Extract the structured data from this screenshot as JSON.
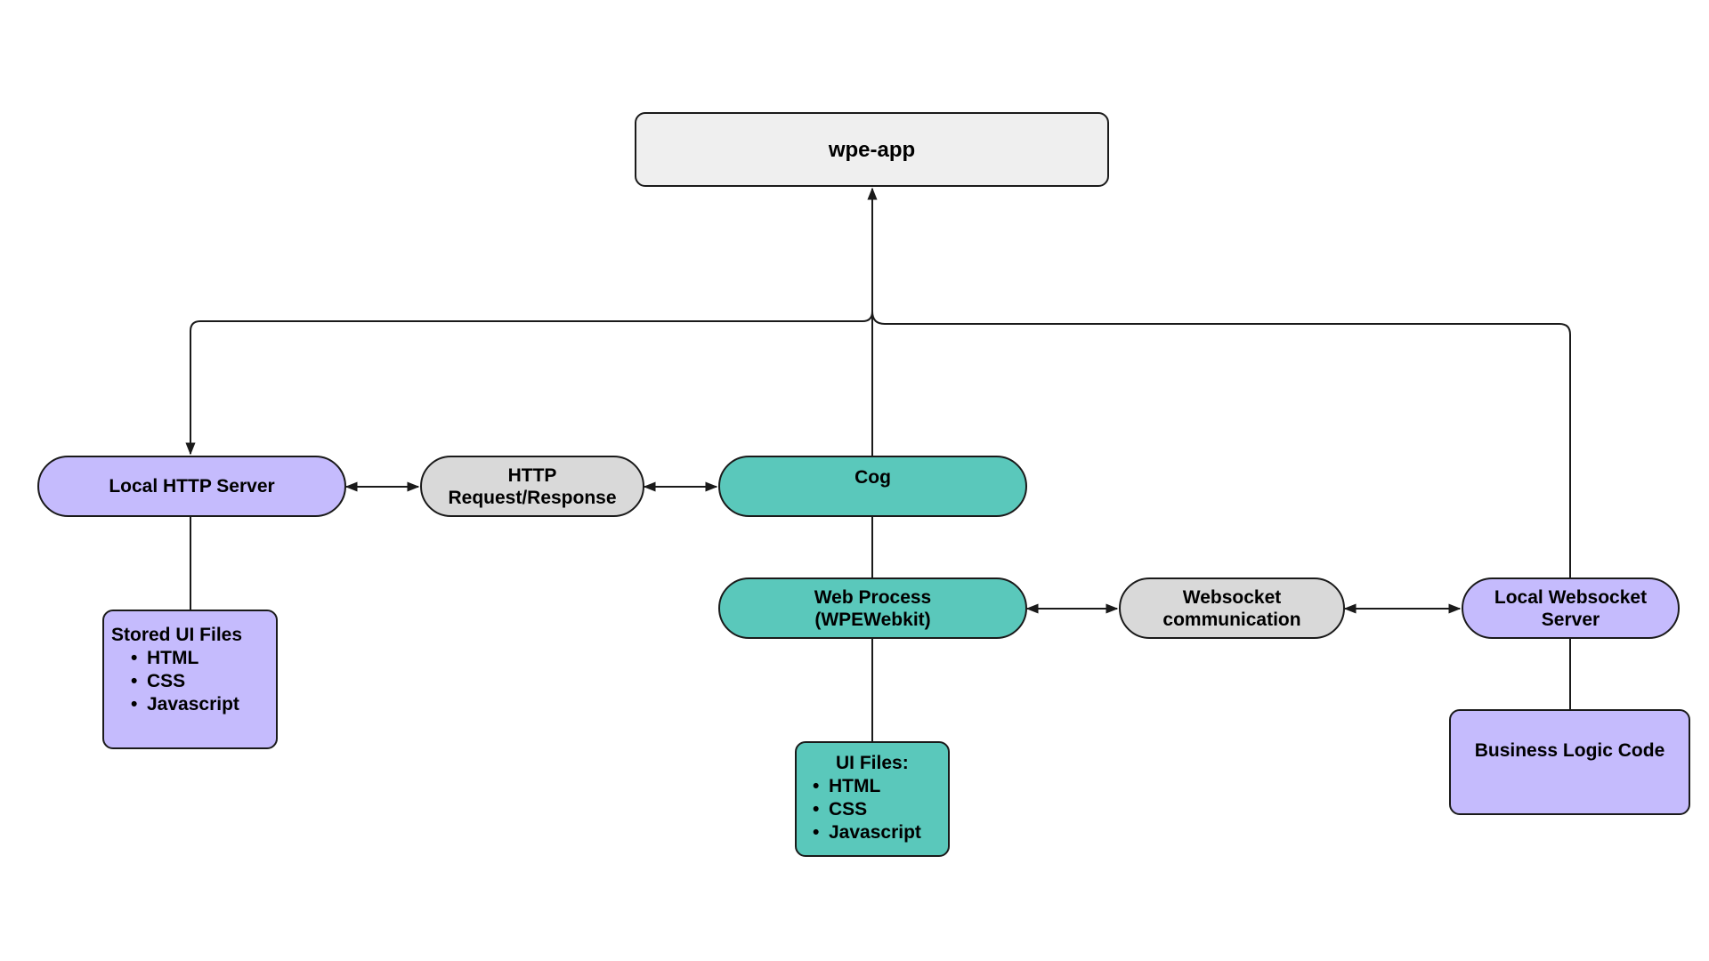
{
  "diagram": {
    "nodes": {
      "wpe_app": {
        "label": "wpe-app"
      },
      "local_http_server": {
        "label": "Local HTTP Server"
      },
      "http_request_response": {
        "line1": "HTTP",
        "line2": "Request/Response"
      },
      "cog": {
        "label": "Cog"
      },
      "web_process": {
        "line1": "Web Process",
        "line2": "(WPEWebkit)"
      },
      "websocket_communication": {
        "line1": "Websocket",
        "line2": "communication"
      },
      "local_websocket_server": {
        "line1": "Local Websocket",
        "line2": "Server"
      },
      "stored_ui_files": {
        "title": "Stored UI Files",
        "items": [
          "HTML",
          "CSS",
          "Javascript"
        ]
      },
      "ui_files": {
        "title": "UI Files:",
        "items": [
          "HTML",
          "CSS",
          "Javascript"
        ]
      },
      "business_logic_code": {
        "label": "Business Logic Code"
      }
    },
    "edges": [
      {
        "from": "cog",
        "to": "wpe_app",
        "arrow": "end"
      },
      {
        "from": "wpe_app",
        "to": "local_http_server",
        "arrow": "end"
      },
      {
        "from": "local_websocket_server",
        "to": "wpe_app",
        "arrow": "none"
      },
      {
        "from": "local_http_server",
        "to": "http_request_response",
        "arrow": "both"
      },
      {
        "from": "http_request_response",
        "to": "cog",
        "arrow": "both"
      },
      {
        "from": "cog",
        "to": "web_process",
        "arrow": "none"
      },
      {
        "from": "web_process",
        "to": "websocket_communication",
        "arrow": "both"
      },
      {
        "from": "websocket_communication",
        "to": "local_websocket_server",
        "arrow": "both"
      },
      {
        "from": "local_http_server",
        "to": "stored_ui_files",
        "arrow": "none"
      },
      {
        "from": "web_process",
        "to": "ui_files",
        "arrow": "none"
      },
      {
        "from": "local_websocket_server",
        "to": "business_logic_code",
        "arrow": "none"
      }
    ],
    "colors": {
      "stroke": "#1a1a1a",
      "app_fill": "#efefef",
      "connector_fill": "#d9d9d9",
      "server_fill": "#c5bbfd",
      "webkit_fill": "#5ac8bb"
    }
  }
}
